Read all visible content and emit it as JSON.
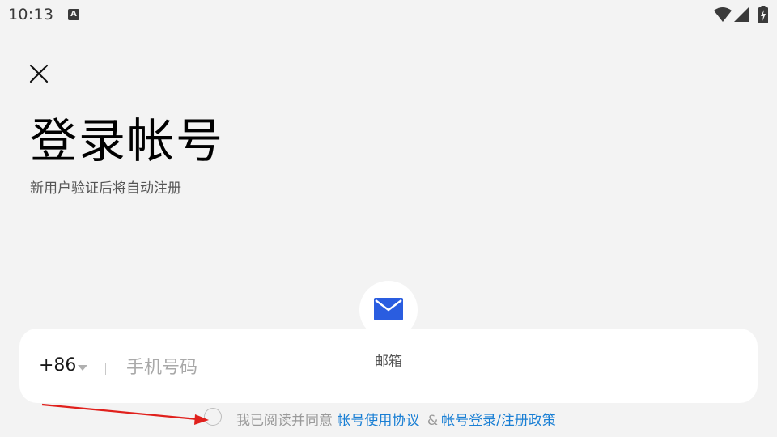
{
  "status_bar": {
    "time": "10:13",
    "notification_icon": "text-a-icon",
    "notification_letter": "A",
    "icons": [
      "wifi-icon",
      "signal-icon",
      "battery-charging-icon"
    ]
  },
  "header": {
    "close_icon": "close-icon",
    "title": "登录帐号",
    "subtitle": "新用户验证后将自动注册"
  },
  "phone_form": {
    "country_code": "+86",
    "divider": "|",
    "phone_placeholder": "手机号码",
    "phone_value": ""
  },
  "alt_login": {
    "email_icon": "mail-icon",
    "email_label": "邮箱"
  },
  "agreement": {
    "checked": false,
    "prefix": "我已阅读并同意",
    "user_agreement": "帐号使用协议",
    "amp": "&",
    "privacy_policy": "帐号登录/注册政策"
  },
  "annotation": {
    "type": "red-arrow",
    "color": "#e0201c"
  },
  "colors": {
    "background": "#f3f3f3",
    "card": "#ffffff",
    "link": "#1a7fd4",
    "email_icon": "#2a5de0"
  }
}
